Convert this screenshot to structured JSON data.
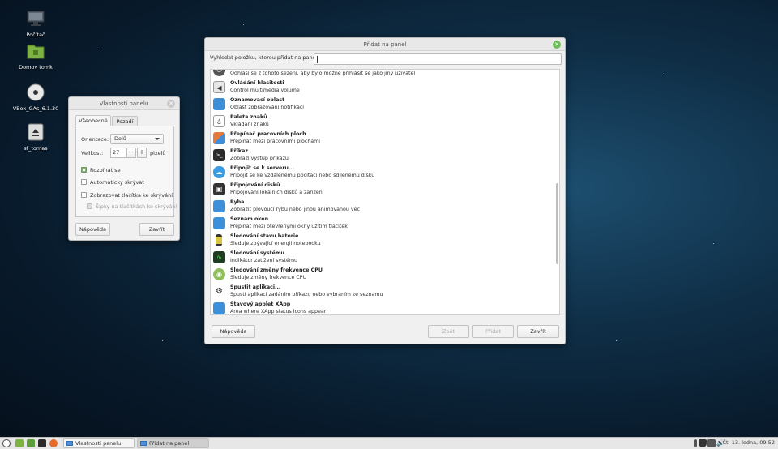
{
  "desktop": {
    "icons": [
      {
        "label": "Počítač",
        "icon": "computer-icon"
      },
      {
        "label": "Domov tomk",
        "icon": "home-folder-icon"
      },
      {
        "label": "VBox_GAs_6.1.30",
        "icon": "disc-icon"
      },
      {
        "label": "sf_tomas",
        "icon": "drive-icon"
      }
    ]
  },
  "add_panel": {
    "title": "Přidat na panel",
    "search_label": "Vyhledat položku, kterou přidat na panel:",
    "search_value": "",
    "items": [
      {
        "title": "",
        "desc": "Odhlásí se z tohoto sezení, aby bylo možné přihlásit se jako jiný uživatel",
        "icon": "logout-icon"
      },
      {
        "title": "Ovládání hlasitosti",
        "desc": "Control multimedia volume",
        "icon": "speaker-icon"
      },
      {
        "title": "Oznamovací oblast",
        "desc": "Oblast zobrazování notifikací",
        "icon": "notification-area-icon"
      },
      {
        "title": "Paleta znaků",
        "desc": "Vkládání znaků",
        "icon": "character-map-icon"
      },
      {
        "title": "Přepínač pracovních ploch",
        "desc": "Přepínat mezi pracovními plochami",
        "icon": "workspace-switcher-icon"
      },
      {
        "title": "Příkaz",
        "desc": "Zobrazí výstup příkazu",
        "icon": "terminal-icon"
      },
      {
        "title": "Připojit se k serveru...",
        "desc": "Připojit se ke vzdálenému počítači nebo sdílenému disku",
        "icon": "cloud-icon"
      },
      {
        "title": "Připojování disků",
        "desc": "Připojování lokálních disků a zařízení",
        "icon": "disk-mount-icon"
      },
      {
        "title": "Ryba",
        "desc": "Zobrazit plovoucí rybu nebo jinou animovanou věc",
        "icon": "fish-icon"
      },
      {
        "title": "Seznam oken",
        "desc": "Přepínat mezi otevřenými okny užitím tlačítek",
        "icon": "window-list-icon"
      },
      {
        "title": "Sledování stavu baterie",
        "desc": "Sleduje zbývající energii notebooku",
        "icon": "battery-icon"
      },
      {
        "title": "Sledování systému",
        "desc": "Indikátor zatížení systému",
        "icon": "system-monitor-icon"
      },
      {
        "title": "Sledování změny frekvence CPU",
        "desc": "Sleduje změny frekvence CPU",
        "icon": "cpu-frequency-icon"
      },
      {
        "title": "Spustit aplikaci...",
        "desc": "Spustí aplikaci zadáním příkazu nebo vybráním ze seznamu",
        "icon": "run-gear-icon"
      },
      {
        "title": "Stavový applet XApp",
        "desc": "Area where XApp status icons appear",
        "icon": "xapp-status-icon"
      }
    ],
    "buttons": {
      "help": "Nápověda",
      "back": "Zpět",
      "add": "Přidat",
      "close": "Zavřít"
    }
  },
  "panel_props": {
    "title": "Vlastnosti panelu",
    "tabs": [
      "Všeobecné",
      "Pozadí"
    ],
    "orientation_label": "Orientace:",
    "orientation_value": "Dolů",
    "size_label": "Velikost:",
    "size_value": "27",
    "size_unit": "pixelů",
    "minus": "−",
    "plus": "+",
    "checks": [
      {
        "label": "Rozpínat se",
        "checked": true
      },
      {
        "label": "Automaticky skrývat",
        "checked": false
      },
      {
        "label": "Zobrazovat tlačítka ke skrývání",
        "checked": false
      },
      {
        "label": "Šipky na tlačítkách ke skrývání",
        "checked": false,
        "disabled": true
      }
    ],
    "buttons": {
      "help": "Nápověda",
      "close": "Zavřít"
    }
  },
  "taskbar": {
    "tasks": [
      "Vlastnosti panelu",
      "Přidat na panel"
    ],
    "clock": "Čt, 13. ledna, 09:52"
  },
  "colors": {
    "accent_green": "#6cbf5a",
    "taskbar": "#e7e7e7",
    "desktop_dark": "#0a1d2e"
  }
}
